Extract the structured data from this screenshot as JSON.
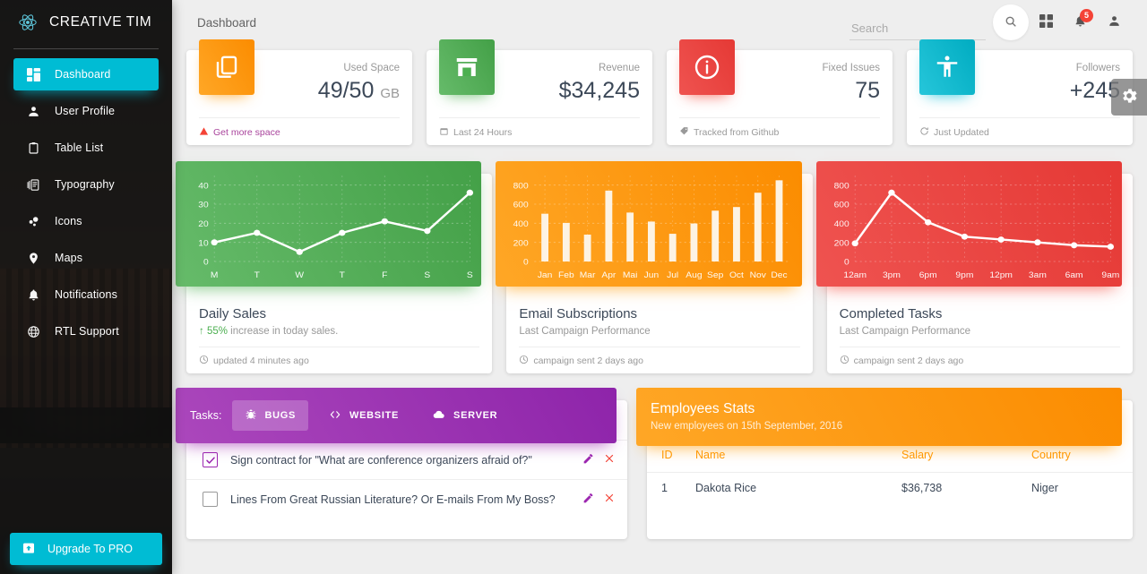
{
  "sidebar": {
    "brand": "CREATIVE TIM",
    "brand_logo_icon": "react-atom-icon",
    "items": [
      {
        "label": "Dashboard",
        "icon": "dashboard-grid-icon",
        "active": true
      },
      {
        "label": "User Profile",
        "icon": "person-icon",
        "active": false
      },
      {
        "label": "Table List",
        "icon": "clipboard-icon",
        "active": false
      },
      {
        "label": "Typography",
        "icon": "library-books-icon",
        "active": false
      },
      {
        "label": "Icons",
        "icon": "bubble-chart-icon",
        "active": false
      },
      {
        "label": "Maps",
        "icon": "location-pin-icon",
        "active": false
      },
      {
        "label": "Notifications",
        "icon": "bell-icon",
        "active": false
      },
      {
        "label": "RTL Support",
        "icon": "globe-icon",
        "active": false
      }
    ],
    "upgrade": {
      "label": "Upgrade To PRO",
      "icon": "unarchive-icon"
    }
  },
  "topbar": {
    "page_title": "Dashboard",
    "search_placeholder": "Search",
    "search_value": "",
    "search_icon": "search-icon",
    "dashboard_icon": "dashboard-grid-icon",
    "notifications_icon": "bell-icon",
    "notifications_count": "5",
    "person_icon": "person-icon",
    "settings_icon": "gear-icon"
  },
  "stats": [
    {
      "icon": "content-copy-icon",
      "color": "#ff9800",
      "category": "Used Space",
      "value": "49/50",
      "unit": "GB",
      "footer": "Get more space",
      "footer_icon": "warning-icon",
      "footer_is_link": true
    },
    {
      "icon": "store-icon",
      "color": "#4caf50",
      "category": "Revenue",
      "value": "$34,245",
      "unit": "",
      "footer": "Last 24 Hours",
      "footer_icon": "calendar-icon",
      "footer_is_link": false
    },
    {
      "icon": "info-outline-icon",
      "color": "#f44336",
      "category": "Fixed Issues",
      "value": "75",
      "unit": "",
      "footer": "Tracked from Github",
      "footer_icon": "tag-icon",
      "footer_is_link": false
    },
    {
      "icon": "accessibility-icon",
      "color": "#00bcd4",
      "category": "Followers",
      "value": "+245",
      "unit": "",
      "footer": "Just Updated",
      "footer_icon": "update-icon",
      "footer_is_link": false
    }
  ],
  "chart_cards": [
    {
      "title": "Daily Sales",
      "subtitle_prefix": "55%",
      "subtitle": " increase in today sales.",
      "subtitle_icon": "arrow-up-icon",
      "footer": "updated 4 minutes ago",
      "footer_icon": "clock-icon",
      "theme": "green"
    },
    {
      "title": "Email Subscriptions",
      "subtitle_prefix": "",
      "subtitle": "Last Campaign Performance",
      "subtitle_icon": "",
      "footer": "campaign sent 2 days ago",
      "footer_icon": "clock-icon",
      "theme": "orange"
    },
    {
      "title": "Completed Tasks",
      "subtitle_prefix": "",
      "subtitle": "Last Campaign Performance",
      "subtitle_icon": "",
      "footer": "campaign sent 2 days ago",
      "footer_icon": "clock-icon",
      "theme": "red"
    }
  ],
  "chart_data": [
    {
      "type": "line",
      "title": "Daily Sales",
      "categories": [
        "M",
        "T",
        "W",
        "T",
        "F",
        "S",
        "S"
      ],
      "values": [
        10,
        15,
        5,
        15,
        21,
        16,
        36
      ],
      "yticks": [
        0,
        10,
        20,
        30,
        40
      ],
      "ylim": [
        0,
        45
      ],
      "xlabel": "",
      "ylabel": "",
      "grid": true,
      "legend": "none",
      "series_color": "#ffffff",
      "panel_color": "#4caf50"
    },
    {
      "type": "bar",
      "title": "Email Subscriptions",
      "categories": [
        "Jan",
        "Feb",
        "Mar",
        "Apr",
        "Mai",
        "Jun",
        "Jul",
        "Aug",
        "Sep",
        "Oct",
        "Nov",
        "Dec"
      ],
      "values": [
        500,
        404,
        281,
        742,
        512,
        418,
        290,
        398,
        532,
        570,
        720,
        850
      ],
      "yticks": [
        0,
        200,
        400,
        600,
        800
      ],
      "ylim": [
        0,
        900
      ],
      "xlabel": "",
      "ylabel": "",
      "grid": true,
      "legend": "none",
      "series_color": "#ffffff",
      "panel_color": "#ff9800"
    },
    {
      "type": "line",
      "title": "Completed Tasks",
      "categories": [
        "12am",
        "3pm",
        "6pm",
        "9pm",
        "12pm",
        "3am",
        "6am",
        "9am"
      ],
      "values": [
        190,
        720,
        410,
        260,
        230,
        200,
        170,
        155
      ],
      "yticks": [
        0,
        200,
        400,
        600,
        800
      ],
      "ylim": [
        0,
        900
      ],
      "xlabel": "",
      "ylabel": "",
      "grid": true,
      "legend": "none",
      "series_color": "#ffffff",
      "panel_color": "#f44336"
    }
  ],
  "tasks": {
    "label": "Tasks:",
    "tabs": [
      {
        "label": "BUGS",
        "icon": "bug-icon",
        "active": true
      },
      {
        "label": "WEBSITE",
        "icon": "code-icon",
        "active": false
      },
      {
        "label": "SERVER",
        "icon": "cloud-icon",
        "active": false
      }
    ],
    "rows": [
      {
        "checked": true,
        "text": "Sign contract for \"What are conference organizers afraid of?\"",
        "edit_icon": "pencil-icon",
        "delete_icon": "close-icon"
      },
      {
        "checked": false,
        "text": "Lines From Great Russian Literature? Or E-mails From My Boss?",
        "edit_icon": "pencil-icon",
        "delete_icon": "close-icon"
      }
    ]
  },
  "employees": {
    "title": "Employees Stats",
    "subtitle": "New employees on 15th September, 2016",
    "columns": [
      "ID",
      "Name",
      "Salary",
      "Country"
    ],
    "rows": [
      [
        "1",
        "Dakota Rice",
        "$36,738",
        "Niger"
      ]
    ]
  }
}
